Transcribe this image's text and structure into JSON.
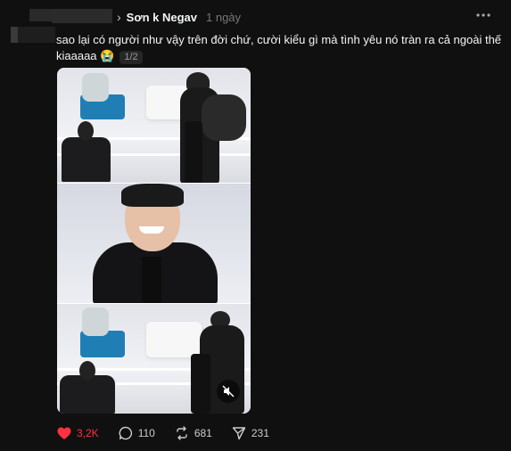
{
  "post": {
    "author": "Sơn k Negav",
    "time": "1 ngày",
    "caption": "sao lại có người như vậy trên đời chứ, cười kiểu gì mà tình yêu nó tràn ra cả ngoài thế kiaaaaa 😭",
    "page_indicator": "1/2"
  },
  "actions": {
    "likes": "3,2K",
    "replies": "110",
    "reposts": "681",
    "shares": "231"
  },
  "colors": {
    "like": "#ff3040",
    "background": "#101010"
  }
}
